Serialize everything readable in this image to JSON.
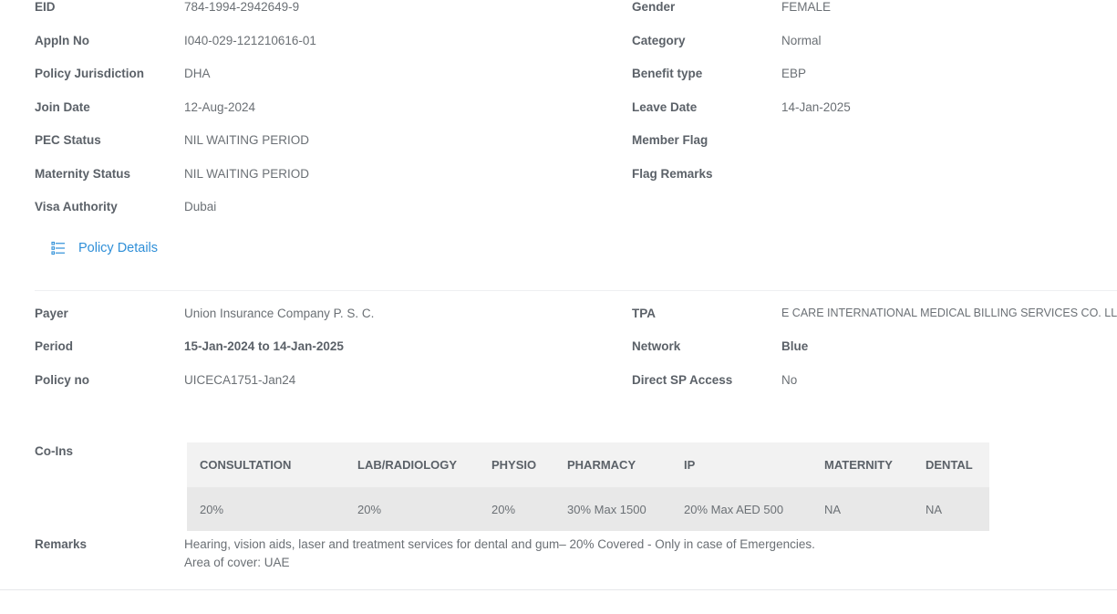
{
  "member_info": {
    "left": [
      {
        "label": "EID",
        "value": "784-1994-2942649-9"
      },
      {
        "label": "Appln No",
        "value": "I040-029-121210616-01"
      },
      {
        "label": "Policy Jurisdiction",
        "value": "DHA"
      },
      {
        "label": "Join Date",
        "value": "12-Aug-2024"
      },
      {
        "label": "PEC Status",
        "value": "NIL WAITING PERIOD"
      },
      {
        "label": "Maternity Status",
        "value": "NIL WAITING PERIOD"
      },
      {
        "label": "Visa Authority",
        "value": "Dubai"
      }
    ],
    "right": [
      {
        "label": "Gender",
        "value": "FEMALE"
      },
      {
        "label": "Category",
        "value": "Normal"
      },
      {
        "label": "Benefit type",
        "value": "EBP"
      },
      {
        "label": "Leave Date",
        "value": "14-Jan-2025"
      },
      {
        "label": "Member Flag",
        "value": ""
      },
      {
        "label": "Flag Remarks",
        "value": ""
      }
    ]
  },
  "policy_section": {
    "title": "Policy Details",
    "icon": "list-icon",
    "accent_color": "#2f8fd8"
  },
  "policy_info": {
    "left": [
      {
        "label": "Payer",
        "value": "Union Insurance Company P. S. C."
      },
      {
        "label": "Period",
        "value": "15-Jan-2024 to 14-Jan-2025"
      },
      {
        "label": "Policy no",
        "value": "UICECA1751-Jan24"
      }
    ],
    "right": [
      {
        "label": "TPA",
        "value": "E CARE INTERNATIONAL MEDICAL BILLING SERVICES CO. LLC"
      },
      {
        "label": "Network",
        "value": "Blue"
      },
      {
        "label": "Direct SP Access",
        "value": "No"
      }
    ]
  },
  "coins": {
    "label": "Co-Ins",
    "headers": [
      "CONSULTATION",
      "LAB/RADIOLOGY",
      "PHYSIO",
      "PHARMACY",
      "IP",
      "MATERNITY",
      "DENTAL"
    ],
    "values": [
      "20%",
      "20%",
      "20%",
      "30% Max 1500",
      "20% Max AED 500",
      "NA",
      "NA"
    ]
  },
  "remarks": {
    "label": "Remarks",
    "lines": [
      "Hearing, vision aids, laser and treatment services for dental and gum– 20% Covered - Only in case of Emergencies.",
      "Area of cover: UAE"
    ]
  }
}
